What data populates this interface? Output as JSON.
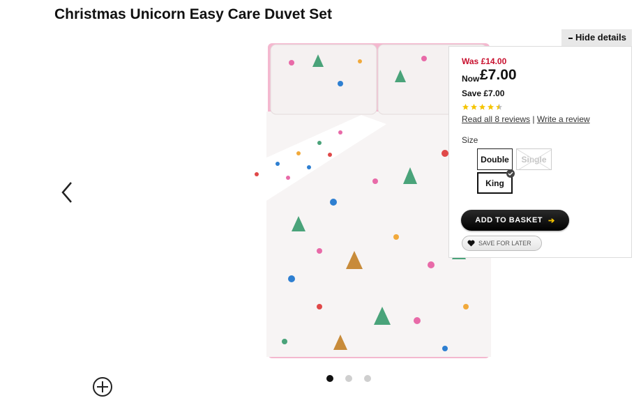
{
  "product": {
    "title": "Christmas Unicorn Easy Care Duvet Set",
    "image_icon": "duvet-set-image"
  },
  "details_panel": {
    "hide_label": "Hide details",
    "was_price": "Was £14.00",
    "now_label": "Now",
    "now_price": "£7.00",
    "save_text": "Save £7.00",
    "rating": 4.5,
    "rating_max": 5,
    "read_reviews": "Read all 8 reviews",
    "separator": "|",
    "write_review": "Write a review",
    "size_label": "Size",
    "sizes": [
      "Double",
      "Single",
      "King"
    ],
    "selected_size": "King",
    "add_to_basket": "ADD TO BASKET",
    "save_for_later": "SAVE FOR LATER"
  },
  "carousel": {
    "slide_count": 3,
    "active_slide": 1
  },
  "colors": {
    "price_red": "#c8102e",
    "star_gold": "#f5c400",
    "duvet_pink": "#f4b8cf"
  }
}
